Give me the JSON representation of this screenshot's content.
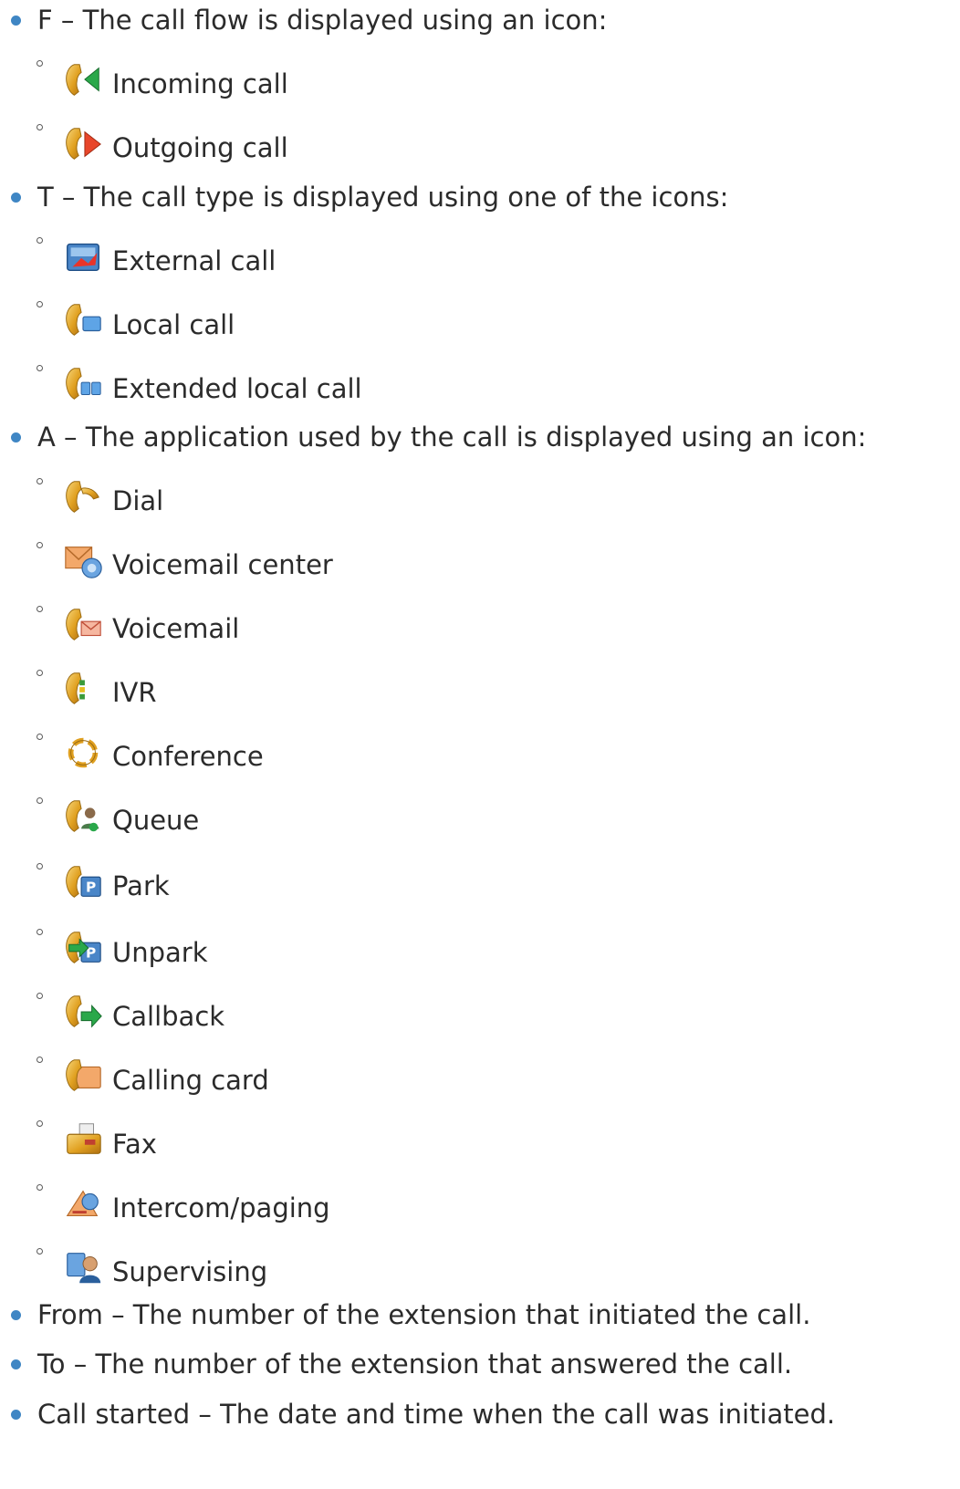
{
  "items": [
    {
      "label": "F – The call flow is displayed using an icon:"
    },
    {
      "label": "Incoming call",
      "icon": "incoming-call-icon"
    },
    {
      "label": "Outgoing call",
      "icon": "outgoing-call-icon"
    },
    {
      "label": "T – The call type is displayed using one of the icons:"
    },
    {
      "label": "External call",
      "icon": "external-call-icon"
    },
    {
      "label": "Local call",
      "icon": "local-call-icon"
    },
    {
      "label": "Extended local call",
      "icon": "extended-local-call-icon"
    },
    {
      "label": "A – The application used by the call is displayed using an icon:"
    },
    {
      "label": "Dial",
      "icon": "dial-icon"
    },
    {
      "label": "Voicemail center",
      "icon": "voicemail-center-icon"
    },
    {
      "label": "Voicemail",
      "icon": "voicemail-icon"
    },
    {
      "label": "IVR",
      "icon": "ivr-icon"
    },
    {
      "label": "Conference",
      "icon": "conference-icon"
    },
    {
      "label": "Queue",
      "icon": "queue-icon"
    },
    {
      "label": "Park",
      "icon": "park-icon"
    },
    {
      "label": "Unpark",
      "icon": "unpark-icon"
    },
    {
      "label": "Callback",
      "icon": "callback-icon"
    },
    {
      "label": "Calling card",
      "icon": "calling-card-icon"
    },
    {
      "label": "Fax",
      "icon": "fax-icon"
    },
    {
      "label": "Intercom/paging",
      "icon": "intercom-paging-icon"
    },
    {
      "label": "Supervising",
      "icon": "supervising-icon"
    },
    {
      "label": "From – The number of the extension that initiated the call."
    },
    {
      "label": "To – The number of the extension that answered the call."
    },
    {
      "label": "Call started – The date and time when the call was initiated."
    }
  ]
}
